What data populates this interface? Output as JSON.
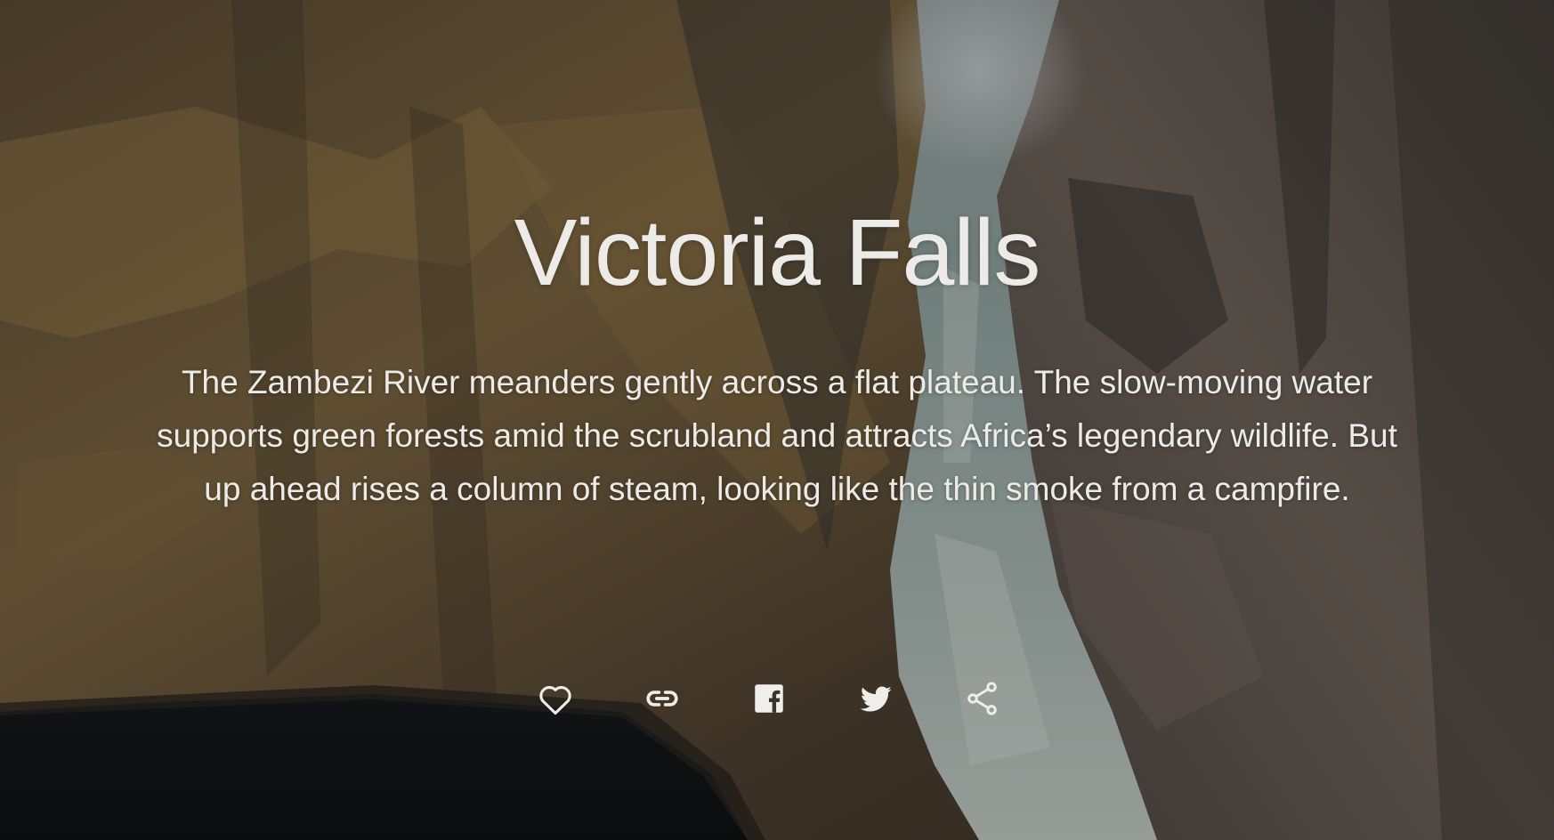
{
  "story": {
    "title": "Victoria Falls",
    "description": "The Zambezi River meanders gently across a flat plateau. The slow-moving water supports green forests amid the scrubland and attracts Africa’s legendary wildlife. But up ahead rises a column of steam, looking like the thin smoke from a campfire."
  },
  "actions": [
    {
      "name": "like",
      "icon": "heart-outline-icon"
    },
    {
      "name": "copy-link",
      "icon": "link-icon"
    },
    {
      "name": "facebook",
      "icon": "facebook-icon"
    },
    {
      "name": "twitter",
      "icon": "twitter-icon"
    },
    {
      "name": "share",
      "icon": "share-icon"
    }
  ],
  "colors": {
    "text": "#ecebe8",
    "icon": "#efeeeb"
  }
}
